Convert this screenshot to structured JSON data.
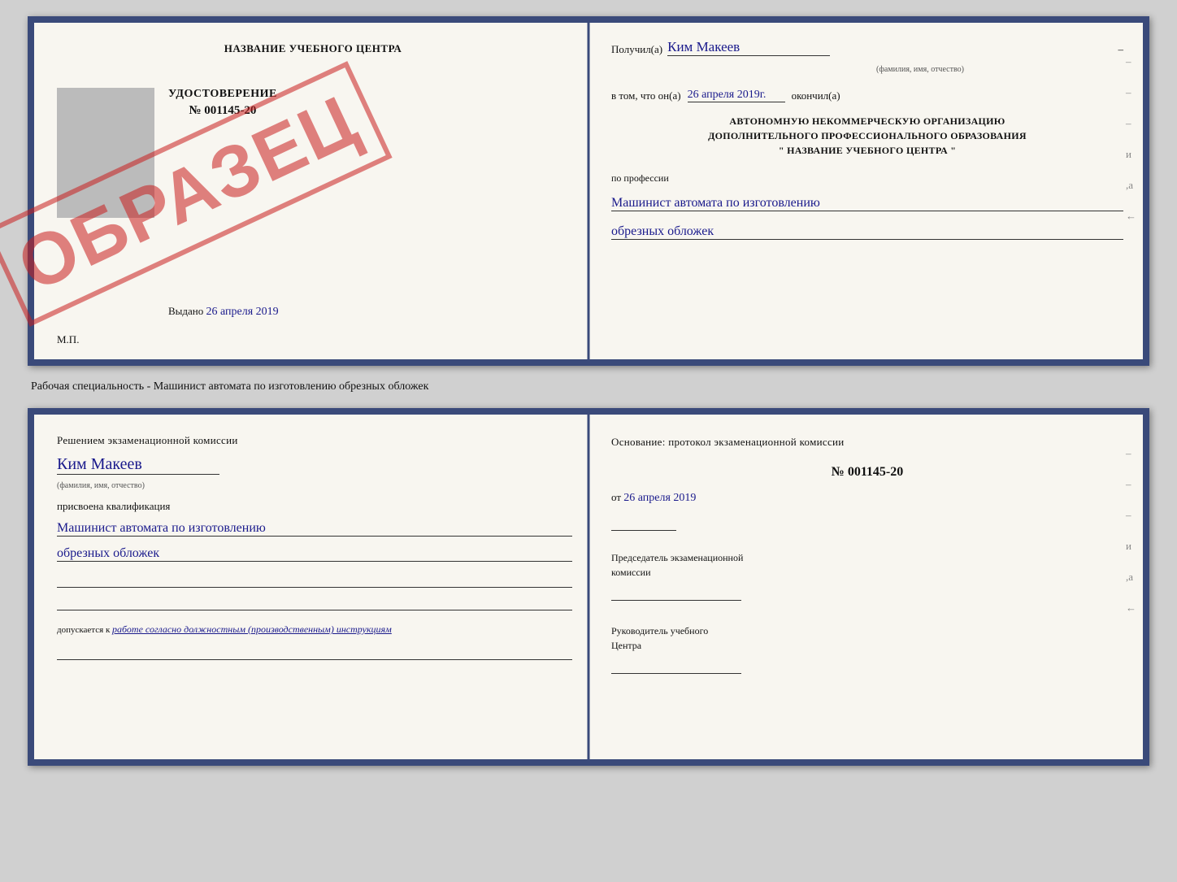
{
  "top_doc": {
    "left": {
      "school_name": "НАЗВАНИЕ УЧЕБНОГО ЦЕНТРА",
      "cert_title": "УДОСТОВЕРЕНИЕ",
      "cert_number": "№ 001145-20",
      "watermark": "ОБРАЗЕЦ",
      "issued_label": "Выдано",
      "issued_date": "26 апреля 2019",
      "mp_label": "М.П."
    },
    "right": {
      "received_label": "Получил(а)",
      "recipient_name": "Ким Макеев",
      "fio_sublabel": "(фамилия, имя, отчество)",
      "dash1": "–",
      "vtom_label": "в том, что он(а)",
      "date_value": "26 апреля 2019г.",
      "finished_label": "окончил(а)",
      "org_line1": "АВТОНОМНУЮ НЕКОММЕРЧЕСКУЮ ОРГАНИЗАЦИЮ",
      "org_line2": "ДОПОЛНИТЕЛЬНОГО ПРОФЕССИОНАЛЬНОГО ОБРАЗОВАНИЯ",
      "org_line3": "\"  НАЗВАНИЕ УЧЕБНОГО ЦЕНТРА  \"",
      "profession_label": "по профессии",
      "profession_value1": "Машинист автомата по изготовлению",
      "profession_value2": "обрезных обложек",
      "dash2": "–",
      "dash3": "–",
      "dash4": "–",
      "and_label": "и",
      "ya_label": ",а",
      "arrow_label": "←"
    }
  },
  "middle": {
    "caption": "Рабочая специальность - Машинист автомата по изготовлению обрезных обложек"
  },
  "bottom_doc": {
    "left": {
      "decision_text": "Решением экзаменационной комиссии",
      "fio_value": "Ким Макеев",
      "fio_sublabel": "(фамилия, имя, отчество)",
      "assigned_label": "присвоена квалификация",
      "qual_value1": "Машинист автомата по изготовлению",
      "qual_value2": "обрезных обложек",
      "admits_prefix": "допускается к",
      "admits_italic": "работе согласно должностным (производственным) инструкциям"
    },
    "right": {
      "basis_label": "Основание: протокол экзаменационной комиссии",
      "protocol_number": "№ 001145-20",
      "date_prefix": "от",
      "date_value": "26 апреля 2019",
      "chairman_label1": "Председатель экзаменационной",
      "chairman_label2": "комиссии",
      "director_label1": "Руководитель учебного",
      "director_label2": "Центра",
      "dash1": "–",
      "dash2": "–",
      "dash3": "–",
      "and_label": "и",
      "ya_label": ",а",
      "arrow_label": "←"
    }
  }
}
